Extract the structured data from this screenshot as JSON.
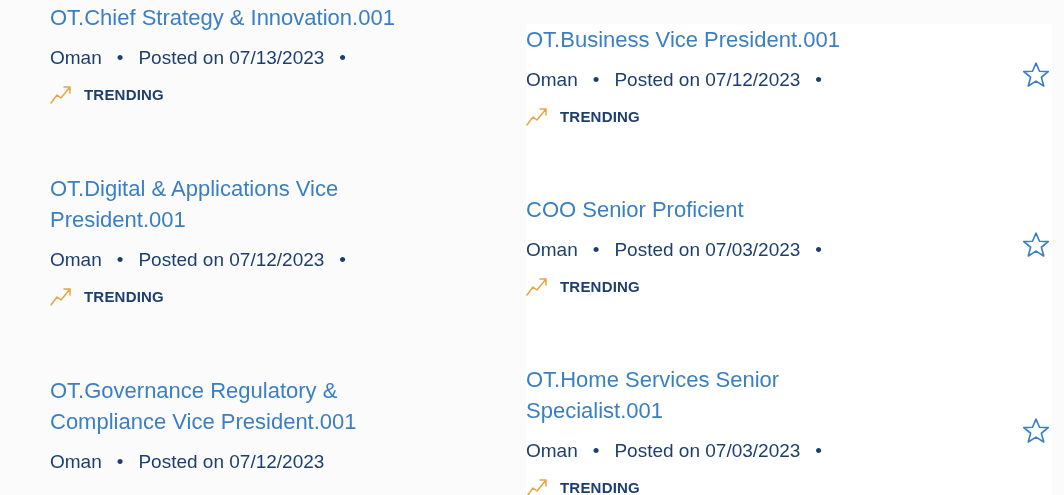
{
  "columns": [
    {
      "jobs": [
        {
          "title": "OT.Chief Strategy & Innovation.001",
          "meta": [
            "Oman",
            "•",
            "Posted on 07/13/2023",
            "•"
          ],
          "trending": "TRENDING"
        },
        {
          "title": "OT.Digital & Applications Vice President.001",
          "meta": [
            "Oman",
            "•",
            "Posted on 07/12/2023",
            "•"
          ],
          "trending": "TRENDING"
        },
        {
          "title": "OT.Governance Regulatory & Compliance Vice President.001",
          "meta": [
            "Oman",
            "•",
            "Posted on 07/12/2023"
          ]
        }
      ]
    },
    {
      "jobs": [
        {
          "title": "OT.Business Vice President.001",
          "meta": [
            "Oman",
            "•",
            "Posted on 07/12/2023",
            "•"
          ],
          "trending": "TRENDING",
          "starred": false
        },
        {
          "title": "COO Senior Proficient",
          "meta": [
            "Oman",
            "•",
            "Posted on 07/03/2023",
            "•"
          ],
          "trending": "TRENDING",
          "starred": false
        },
        {
          "title": "OT.Home Services Senior Specialist.001",
          "meta": [
            "Oman",
            "•",
            "Posted on 07/03/2023",
            "•"
          ],
          "trending": "TRENDING",
          "starred": false
        }
      ]
    }
  ]
}
